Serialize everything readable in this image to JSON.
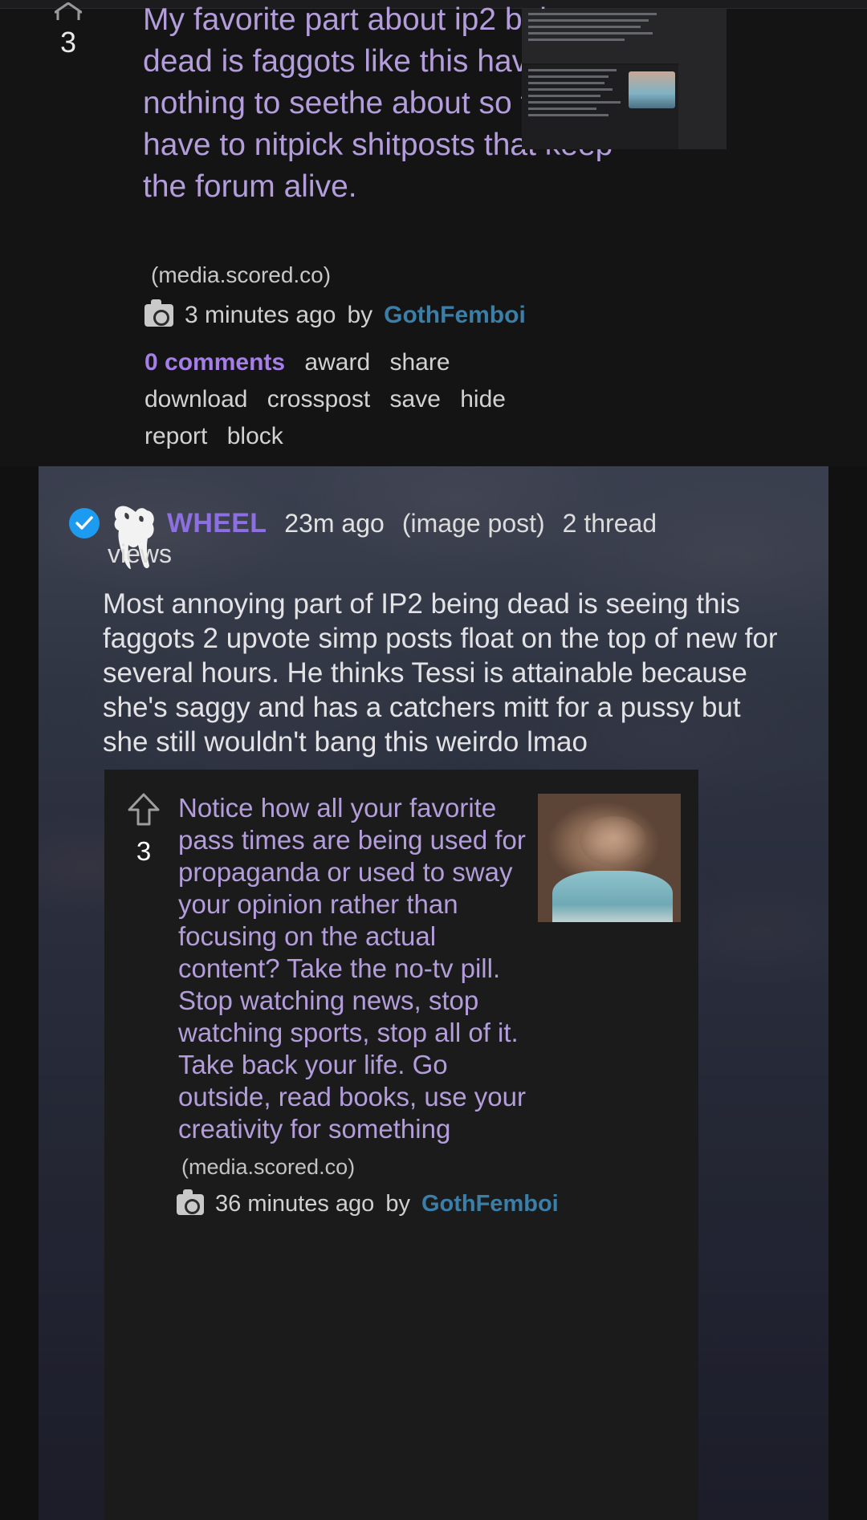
{
  "post_top": {
    "score": "3",
    "vote_icon": "upvote-arrow-icon",
    "title": "My favorite part about ip2 being dead is faggots like this have nothing to seethe about so they have to nitpick shitposts that keep the forum alive.",
    "domain": "(media.scored.co)",
    "media_icon": "camera-icon",
    "timestamp": "3 minutes ago",
    "by_label": "by",
    "author": "GothFemboi",
    "actions_row1": [
      "0 comments",
      "award",
      "share"
    ],
    "actions_row2": [
      "download",
      "crosspost",
      "save",
      "hide"
    ],
    "actions_row3": [
      "report",
      "block"
    ],
    "comments_link": "0 comments"
  },
  "post_wheel": {
    "verified_icon": "verified-checkmark-icon",
    "avatar_icon": "wolf-avatar-icon",
    "community": "WHEEL",
    "age": "23m ago",
    "post_type": "(image post)",
    "thread_views": "2 thread views",
    "thread_views_part1": "2 thread",
    "thread_views_part2": "views",
    "body": "Most annoying part of IP2 being dead is seeing this faggots 2 upvote simp posts float on the top of new for several hours. He thinks Tessi is attainable because she's saggy and has a catchers mitt for a pussy but she still wouldn't bang this weirdo lmao",
    "quoted_post": {
      "score": "3",
      "vote_icon": "upvote-arrow-outline-icon",
      "title": "Notice how all your favorite pass times are being used for propaganda or used to sway your opinion rather than focusing on the actual content? Take the no-tv pill. Stop watching news, stop watching sports, stop all of it. Take back your life. Go outside, read books, use your creativity for something",
      "domain": "(media.scored.co)",
      "media_icon": "camera-icon",
      "timestamp": "36 minutes ago",
      "by_label": "by",
      "author": "GothFemboi",
      "thumbnail_icon": "post-thumbnail-image"
    }
  },
  "colors": {
    "link_purple": "#b39ddb",
    "community_purple": "#8c6fe0",
    "author_blue": "#3b7ea8",
    "verified_blue": "#1d9bf0",
    "page_bg": "#111111",
    "card_bg": "#1b1b1b"
  }
}
